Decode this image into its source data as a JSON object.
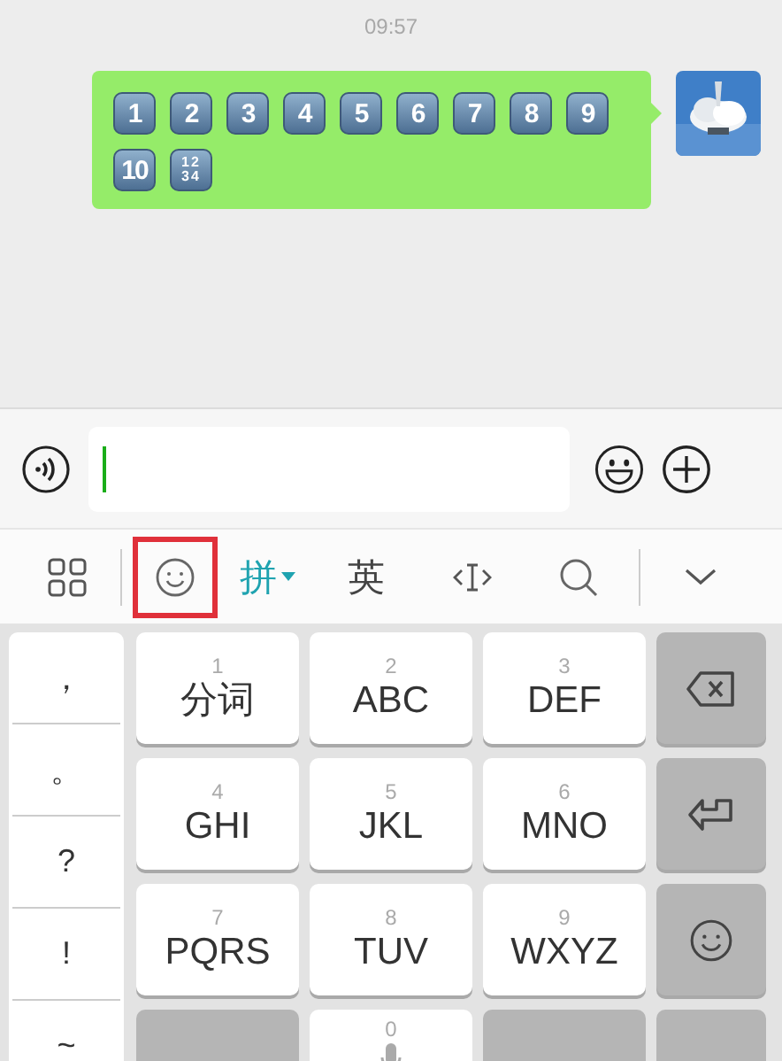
{
  "status": {
    "time": "09:57"
  },
  "messages": [
    {
      "keycaps": [
        "1",
        "2",
        "3",
        "4",
        "5",
        "6",
        "7",
        "8",
        "9",
        "10",
        "1234"
      ]
    }
  ],
  "toolbar": [
    {
      "kind": "apps"
    },
    {
      "kind": "divider"
    },
    {
      "kind": "emoji",
      "highlighted": true
    },
    {
      "kind": "text",
      "label": "拼",
      "selected": true
    },
    {
      "kind": "text",
      "label": "英",
      "selected": false
    },
    {
      "kind": "cursor"
    },
    {
      "kind": "search"
    },
    {
      "kind": "divider"
    },
    {
      "kind": "collapse"
    }
  ],
  "keyboard": {
    "punctuation": [
      "，",
      "。",
      "?",
      "!",
      "~"
    ],
    "keys": [
      {
        "kind": "letter",
        "digit": "1",
        "label": "分词"
      },
      {
        "kind": "letter",
        "digit": "2",
        "label": "ABC"
      },
      {
        "kind": "letter",
        "digit": "3",
        "label": "DEF"
      },
      {
        "kind": "backspace"
      },
      {
        "kind": "letter",
        "digit": "4",
        "label": "GHI"
      },
      {
        "kind": "letter",
        "digit": "5",
        "label": "JKL"
      },
      {
        "kind": "letter",
        "digit": "6",
        "label": "MNO"
      },
      {
        "kind": "enter"
      },
      {
        "kind": "letter",
        "digit": "7",
        "label": "PQRS"
      },
      {
        "kind": "letter",
        "digit": "8",
        "label": "TUV"
      },
      {
        "kind": "letter",
        "digit": "9",
        "label": "WXYZ"
      },
      {
        "kind": "emoji"
      },
      {
        "kind": "lang"
      },
      {
        "kind": "space",
        "digit": "0"
      },
      {
        "kind": "function"
      },
      {
        "kind": "function"
      }
    ]
  }
}
